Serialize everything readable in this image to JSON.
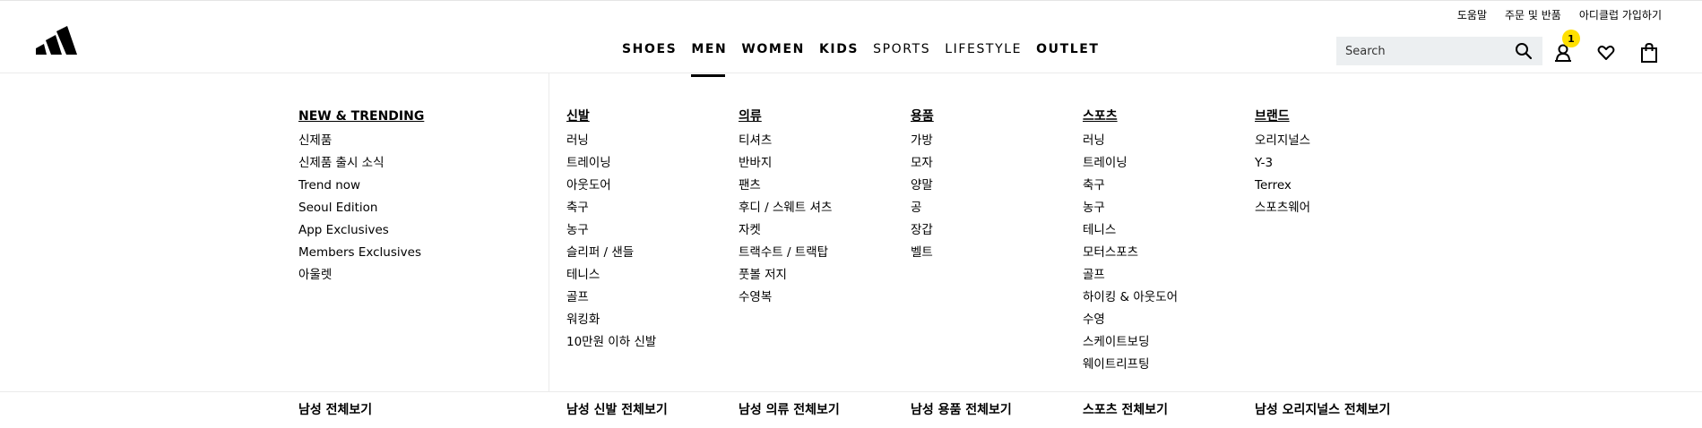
{
  "utility_links": [
    "도움말",
    "주문 및 반품",
    "아디클럽 가입하기"
  ],
  "nav": [
    "SHOES",
    "MEN",
    "WOMEN",
    "KIDS",
    "SPORTS",
    "LIFESTYLE",
    "OUTLET"
  ],
  "nav_active": "MEN",
  "search": {
    "placeholder": "Search"
  },
  "account": {
    "badge": "1"
  },
  "icons": {
    "logo": "adidas-logo",
    "search": "magnifier-icon",
    "account": "user-icon",
    "wishlist": "heart-icon",
    "bag": "shopping-bag-icon"
  },
  "colors": {
    "badge": "#ffe000",
    "search_bg": "#eceff1",
    "divider": "#ebebeb"
  },
  "menu": {
    "columns": [
      {
        "heading": "NEW & TRENDING",
        "items": [
          "신제품",
          "신제품 출시 소식",
          "Trend now",
          "Seoul Edition",
          "App Exclusives",
          "Members Exclusives",
          "아울렛"
        ]
      },
      {
        "heading": "신발",
        "items": [
          "러닝",
          "트레이닝",
          "아웃도어",
          "축구",
          "농구",
          "슬리퍼 / 샌들",
          "테니스",
          "골프",
          "워킹화",
          "10만원 이하 신발"
        ]
      },
      {
        "heading": "의류",
        "items": [
          "티셔츠",
          "반바지",
          "팬츠",
          "후디 / 스웨트 셔츠",
          "자켓",
          "트랙수트 / 트랙탑",
          "풋볼 저지",
          "수영복"
        ]
      },
      {
        "heading": "용품",
        "items": [
          "가방",
          "모자",
          "양말",
          "공",
          "장갑",
          "벨트"
        ]
      },
      {
        "heading": "스포츠",
        "items": [
          "러닝",
          "트레이닝",
          "축구",
          "농구",
          "테니스",
          "모터스포츠",
          "골프",
          "하이킹 & 아웃도어",
          "수영",
          "스케이트보딩",
          "웨이트리프팅"
        ]
      },
      {
        "heading": "브랜드",
        "items": [
          "오리지널스",
          "Y-3",
          "Terrex",
          "스포츠웨어"
        ]
      }
    ],
    "footer_links": [
      "남성 전체보기",
      "남성 신발 전체보기",
      "남성 의류 전체보기",
      "남성 용품 전체보기",
      "스포츠 전체보기",
      "남성 오리지널스 전체보기"
    ]
  }
}
